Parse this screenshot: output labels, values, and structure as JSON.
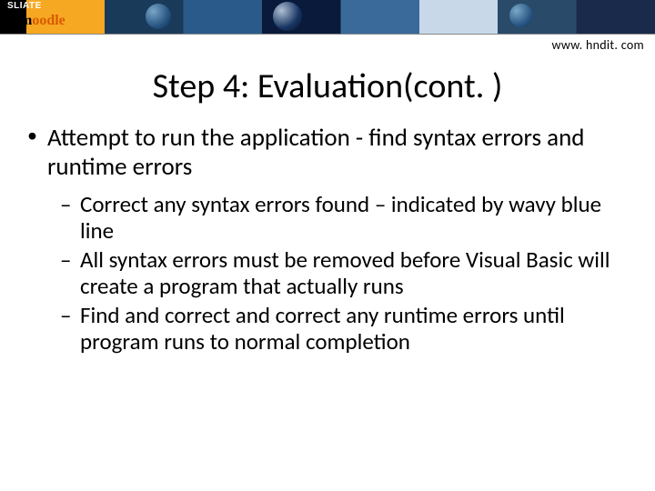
{
  "header": {
    "logo_top": "SLIATE",
    "logo_main_a": "m",
    "logo_main_b": "oodle",
    "url": "www. hndit. com"
  },
  "title": "Step 4:  Evaluation(cont. )",
  "bullets": {
    "level1": [
      "Attempt to run the application - find syntax errors and runtime errors"
    ],
    "level2": [
      "Correct any syntax errors found – indicated by wavy blue line",
      "All syntax errors must be removed before Visual Basic will create a program that actually runs",
      "Find and correct and correct any runtime errors until program runs to normal completion"
    ]
  }
}
